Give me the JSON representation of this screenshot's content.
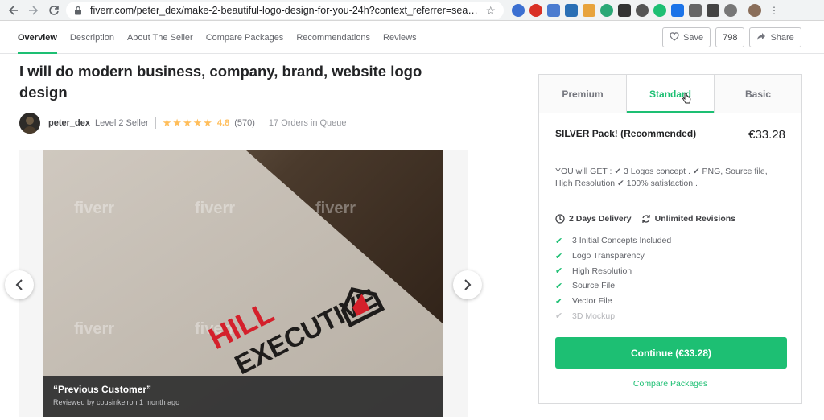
{
  "browser": {
    "url": "fiverr.com/peter_dex/make-2-beautiful-logo-design-for-you-24h?context_referrer=search_...",
    "nav_icons": [
      "back-icon",
      "forward-icon",
      "reload-icon"
    ]
  },
  "nav": {
    "tabs": [
      "Overview",
      "Description",
      "About The Seller",
      "Compare Packages",
      "Recommendations",
      "Reviews"
    ],
    "active_tab": "Overview",
    "save_label": "Save",
    "save_count": "798",
    "share_label": "Share"
  },
  "gig": {
    "title": "I will do modern business, company, brand, website logo design",
    "seller_name": "peter_dex",
    "seller_level": "Level 2 Seller",
    "rating": "4.8",
    "review_count": "(570)",
    "stars": 5,
    "queue": "17 Orders in Queue"
  },
  "gallery": {
    "watermark": "fiverr",
    "logo_text_1": "HILL",
    "logo_text_2": "EXECUTIVE",
    "caption_quote": "“Previous Customer”",
    "caption_meta": "Reviewed by cousinkeiron 1 month ago"
  },
  "package": {
    "tabs": [
      "Premium",
      "Standard",
      "Basic"
    ],
    "active_tab": "Standard",
    "name": "SILVER Pack! (Recommended)",
    "price": "€33.28",
    "description": "YOU will GET : ✔ 3 Logos concept . ✔ PNG, Source file, High Resolution ✔ 100% satisfaction .",
    "delivery": "2 Days Delivery",
    "revisions": "Unlimited Revisions",
    "features": [
      {
        "label": "3 Initial Concepts Included",
        "included": true
      },
      {
        "label": "Logo Transparency",
        "included": true
      },
      {
        "label": "High Resolution",
        "included": true
      },
      {
        "label": "Source File",
        "included": true
      },
      {
        "label": "Vector File",
        "included": true
      },
      {
        "label": "3D Mockup",
        "included": false
      }
    ],
    "continue_label": "Continue (€33.28)",
    "compare_label": "Compare Packages"
  },
  "colors": {
    "accent": "#1dbf73",
    "star": "#ffbe5b"
  }
}
